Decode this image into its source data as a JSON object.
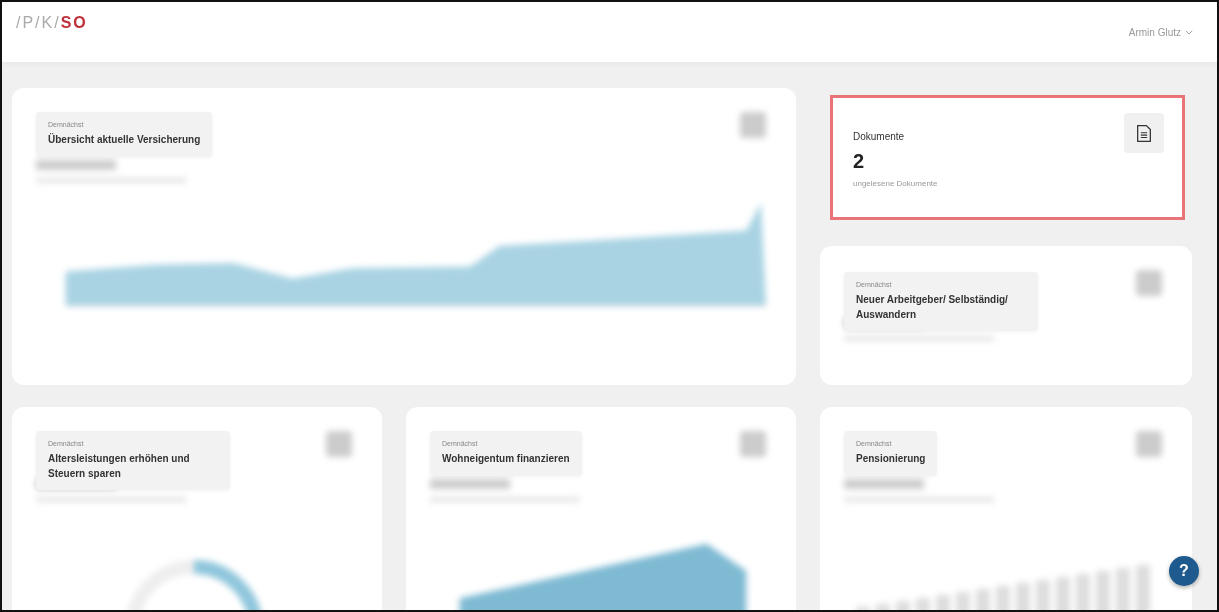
{
  "header": {
    "logo": {
      "prefix": "/P/K/",
      "accent": "SO"
    },
    "user": {
      "name": "Armin Glutz"
    }
  },
  "cards": [
    {
      "kind": "coming_soon",
      "badge": "Demnächst",
      "title": "Übersicht aktuelle Versicherung",
      "preview": {
        "kind": "area"
      }
    },
    {
      "kind": "documents",
      "title": "Dokumente",
      "count": "2",
      "subtitle": "ungelesene Dokumente",
      "highlighted": true
    },
    {
      "kind": "coming_soon",
      "badge": "Demnächst",
      "title": "Neuer Arbeitgeber/ Selbständig/ Auswandern"
    },
    {
      "kind": "coming_soon",
      "badge": "Demnächst",
      "title": "Altersleistungen erhöhen und Steuern sparen",
      "preview": {
        "kind": "donut"
      }
    },
    {
      "kind": "coming_soon",
      "badge": "Demnächst",
      "title": "Wohneigentum finanzieren",
      "preview": {
        "kind": "slope"
      }
    },
    {
      "kind": "coming_soon",
      "badge": "Demnächst",
      "title": "Pensionierung",
      "preview": {
        "kind": "bars"
      }
    }
  ],
  "help": {
    "label": "?"
  }
}
